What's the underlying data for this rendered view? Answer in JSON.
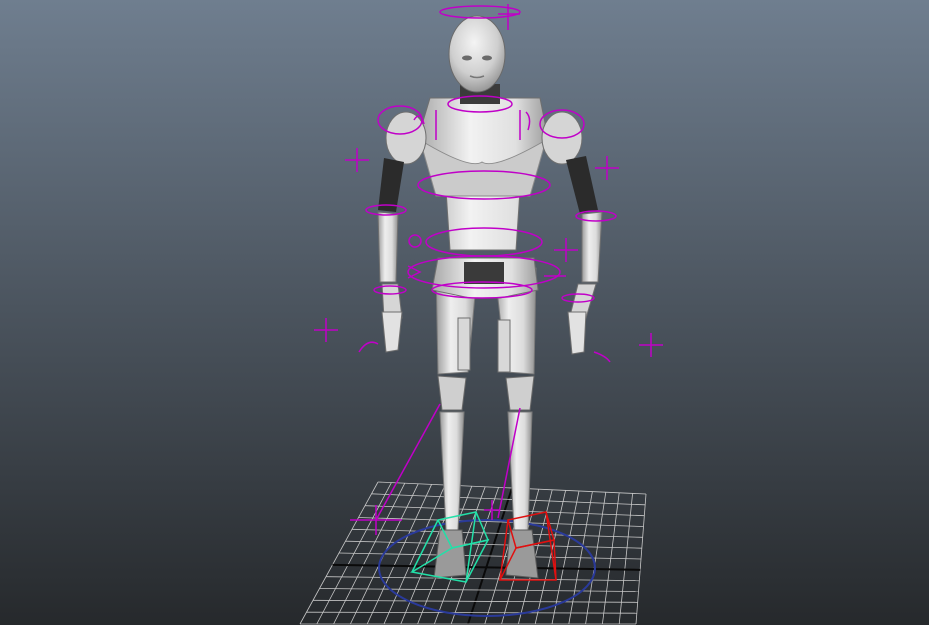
{
  "viewport": {
    "background_top": "#6f7e8f",
    "background_bottom": "#26292c"
  },
  "colors": {
    "grid_line": "#c8c8c8",
    "grid_axis": "#0a0a0a",
    "ground_circle": "#2a3a9a",
    "control": "#c000c8",
    "foot_control_left": "#22e0a8",
    "foot_control_right": "#e01010",
    "body_light": "#e6e6e6",
    "body_mid": "#b9b9b9",
    "body_shadow": "#8a8a8a",
    "body_dark": "#2c2c2c"
  },
  "scene": {
    "icons": [
      "perspective-grid-icon",
      "character-rig-icon",
      "head-control-icon",
      "chest-control-icon",
      "hip-control-icon",
      "pole-vector-icon",
      "foot-ik-control-icon"
    ]
  }
}
